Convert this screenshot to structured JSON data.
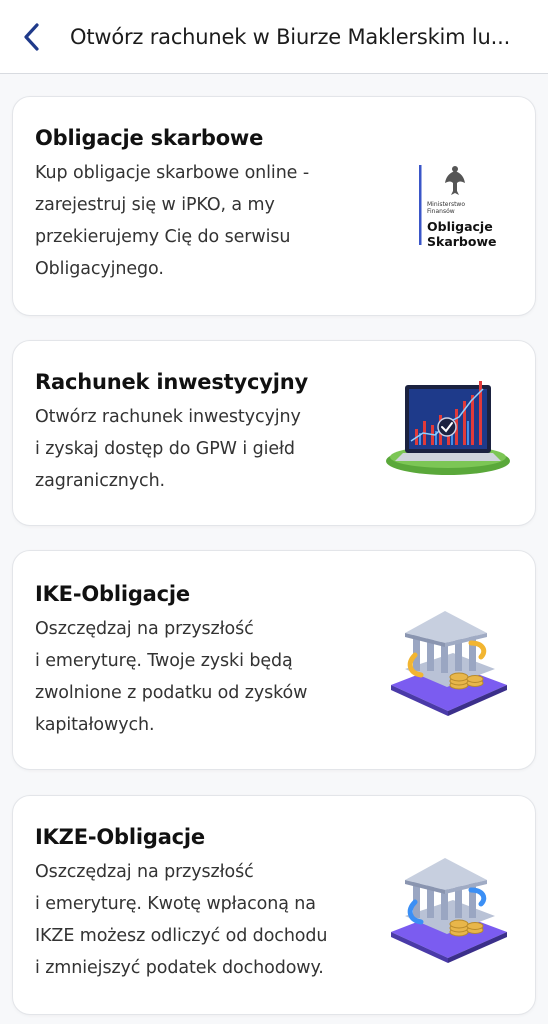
{
  "header": {
    "title": "Otwórz rachunek w Biurze Maklerskim lu..."
  },
  "cards": [
    {
      "title": "Obligacje skarbowe",
      "description": "Kup obligacje skarbowe online -\n zarejestruj się w iPKO, a my\nprzekierujemy Cię do serwisu\nObligacyjnego.",
      "logo": {
        "line1": "Ministerstwo",
        "line2": "Finansów",
        "line3": "Obligacje",
        "line4": "Skarbowe"
      }
    },
    {
      "title": "Rachunek inwestycyjny",
      "description": "Otwórz rachunek inwestycyjny\ni zyskaj dostęp do GPW i giełd\nzagranicznych.",
      "image": "laptop-chart-icon"
    },
    {
      "title": "IKE-Obligacje",
      "description": "Oszczędzaj na przyszłość\ni emeryturę. Twoje zyski będą\nzwolnione z podatku od zysków\nkapitałowych.",
      "image": "bank-coins-icon"
    },
    {
      "title": "IKZE-Obligacje",
      "description": "Oszczędzaj na przyszłość\ni emeryturę. Kwotę wpłaconą na\nIKZE możesz odliczyć od dochodu\ni zmniejszyć podatek dochodowy.",
      "image": "bank-coins-icon"
    }
  ],
  "colors": {
    "accent": "#1f3a8a",
    "background": "#f7f8fa",
    "card": "#ffffff"
  }
}
